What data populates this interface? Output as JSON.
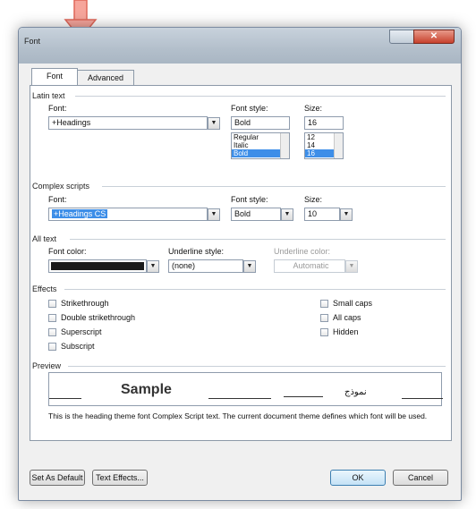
{
  "dialog": {
    "title": "Font",
    "close_glyph": "✕"
  },
  "tabs": [
    {
      "label": "Font"
    },
    {
      "label": "Advanced"
    }
  ],
  "latin": {
    "group_label": "Latin text",
    "font_label": "Font:",
    "font_value": "+Headings",
    "style_label": "Font style:",
    "style_value": "Bold",
    "style_options": [
      "Regular",
      "Italic",
      "Bold"
    ],
    "size_label": "Size:",
    "size_value": "16",
    "size_options": [
      "12",
      "14",
      "16"
    ]
  },
  "complex": {
    "group_label": "Complex scripts",
    "font_label": "Font:",
    "font_value": "+Headings CS",
    "style_label": "Font style:",
    "style_value": "Bold",
    "size_label": "Size:",
    "size_value": "10"
  },
  "alltext": {
    "group_label": "All text",
    "color_label": "Font color:",
    "underline_label": "Underline style:",
    "underline_value": "(none)",
    "underline_color_label": "Underline color:",
    "underline_color_value": "Automatic",
    "font_color": "#1a1a1a"
  },
  "effects": {
    "group_label": "Effects",
    "left": [
      "Strikethrough",
      "Double strikethrough",
      "Superscript",
      "Subscript"
    ],
    "right": [
      "Small caps",
      "All caps",
      "Hidden"
    ]
  },
  "preview": {
    "group_label": "Preview",
    "sample": "Sample",
    "sample_cs": "نموذج",
    "description": "This is the heading theme font Complex Script text. The current document theme defines which font will be used."
  },
  "buttons": {
    "set_default": "Set As Default",
    "text_effects": "Text Effects...",
    "ok": "OK",
    "cancel": "Cancel"
  },
  "colors": {
    "accent_arrow": "#f08a7e",
    "selection": "#3d8ee8"
  }
}
